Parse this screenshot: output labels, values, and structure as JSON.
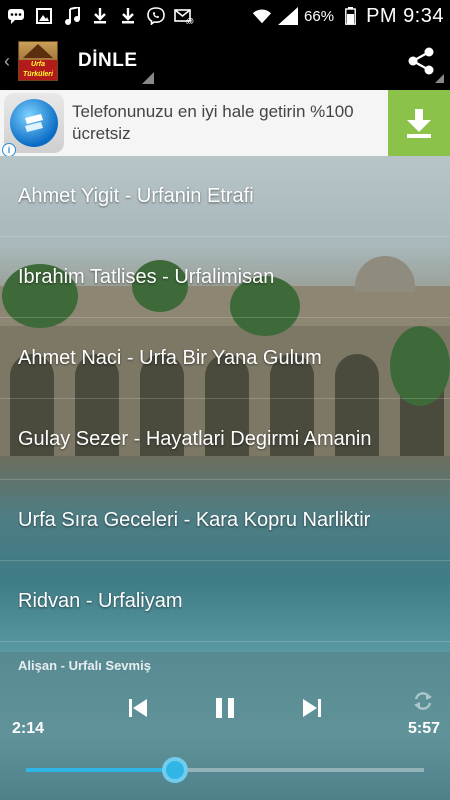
{
  "status_bar": {
    "battery": "66%",
    "am_pm": "PM",
    "time": "9:34",
    "icons": [
      "chat-icon",
      "image-icon",
      "music-icon",
      "download-icon",
      "download-icon",
      "viber-icon",
      "email-icon",
      "wifi-icon",
      "signal-icon",
      "battery-icon"
    ]
  },
  "action_bar": {
    "title": "DİNLE",
    "logo_text": "Urfa Türküleri"
  },
  "ad": {
    "text": "Telefonunuzu en iyi hale getirin %100 ücretsiz",
    "info": "i"
  },
  "songs": [
    "Ahmet Yigit - Urfanin Etrafi",
    "Ibrahim Tatlises - Urfalimisan",
    "Ahmet Naci - Urfa Bir Yana Gulum",
    "Gulay Sezer - Hayatlari Degirmi Amanin",
    "Urfa Sıra Geceleri  - Kara Kopru Narliktir",
    "Ridvan - Urfaliyam"
  ],
  "player": {
    "now_playing": "Alişan - Urfalı Sevmiş",
    "elapsed": "2:14",
    "duration": "5:57",
    "progress_fraction": 0.375
  },
  "colors": {
    "accent": "#2fb6e6",
    "ad_button": "#8bc34a"
  }
}
